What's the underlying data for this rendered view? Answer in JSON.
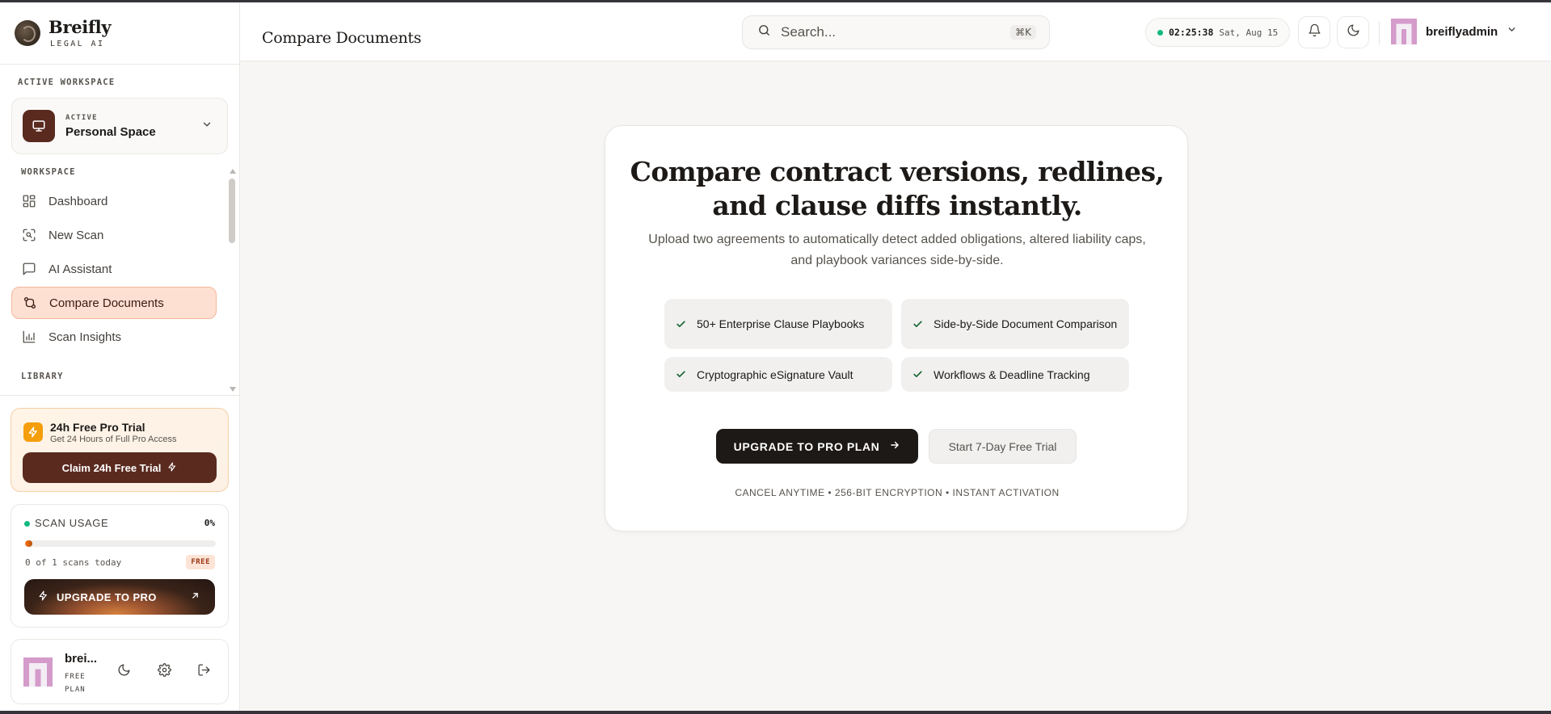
{
  "brand": {
    "name": "Breifly",
    "tagline": "LEGAL AI"
  },
  "sidebar": {
    "workspace_section_label": "ACTIVE WORKSPACE",
    "workspace": {
      "state": "ACTIVE",
      "name": "Personal Space",
      "icon": "monitor-icon"
    },
    "nav_section_label": "WORKSPACE",
    "nav": [
      {
        "label": "Dashboard",
        "icon": "grid-icon",
        "active": false
      },
      {
        "label": "New Scan",
        "icon": "scan-icon",
        "active": false
      },
      {
        "label": "AI Assistant",
        "icon": "chat-icon",
        "active": false
      },
      {
        "label": "Compare Documents",
        "icon": "compare-icon",
        "active": true
      },
      {
        "label": "Scan Insights",
        "icon": "bar-chart-icon",
        "active": false
      }
    ],
    "library_section_label": "LIBRARY",
    "trial": {
      "title": "24h Free Pro Trial",
      "subtitle": "Get 24 Hours of Full Pro Access",
      "button": "Claim 24h Free Trial"
    },
    "usage": {
      "title": "SCAN USAGE",
      "percent_label": "0%",
      "progress": 0,
      "count_text": "0 of 1 scans today",
      "badge": "FREE",
      "button": "UPGRADE TO PRO"
    },
    "user": {
      "name": "brei...",
      "plan": "FREE PLAN"
    }
  },
  "header": {
    "title": "Compare Documents",
    "search_placeholder": "Search...",
    "search_shortcut": "⌘K",
    "clock_time": "02:25:38",
    "clock_date": "Sat, Aug 15",
    "username": "breiflyadmin"
  },
  "main": {
    "headline": "Compare contract versions, redlines, and clause diffs instantly.",
    "subtext": "Upload two agreements to automatically detect added obligations, altered liability caps, and playbook variances side-by-side.",
    "features": [
      "50+ Enterprise Clause Playbooks",
      "Side-by-Side Document Comparison",
      "Cryptographic eSignature Vault",
      "Workflows & Deadline Tracking"
    ],
    "primary_cta": "UPGRADE TO PRO PLAN",
    "secondary_cta": "Start 7-Day Free Trial",
    "fineprint": "CANCEL ANYTIME • 256-BIT ENCRYPTION • INSTANT ACTIVATION"
  },
  "colors": {
    "accent_brown": "#5a2a1f",
    "active_nav_bg": "#fde0d2",
    "status_green": "#10b981",
    "trial_orange": "#f59e0b"
  }
}
